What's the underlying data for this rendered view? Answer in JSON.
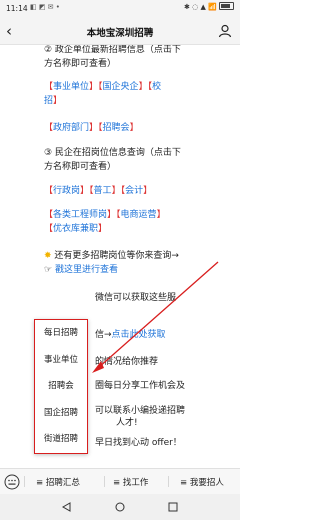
{
  "status_bar": {
    "time": "11:14",
    "left_icons": "◧ ◩ ✉ •",
    "right_icons": "✱ ◌ ▲ 📶"
  },
  "header": {
    "title": "本地宝深圳招聘"
  },
  "article": {
    "l1": "② 政企单位最新招聘信息（点击下",
    "l2": "方名称即可查看）",
    "l3": [
      "【",
      "事业单位",
      "】【",
      "国企央企",
      "】【",
      "校"
    ],
    "l4": [
      "招",
      "】"
    ],
    "l5": [
      "【",
      "政府部门",
      "】【",
      "招聘会",
      "】"
    ],
    "l6": "③ 民企在招岗位信息查询（点击下",
    "l7": "方名称即可查看）",
    "l8": [
      "【",
      "行政岗",
      "】【",
      "普工",
      "】【",
      "会计",
      "】"
    ],
    "l9": [
      "【",
      "各类工程师岗",
      "】【",
      "电商运营",
      "】"
    ],
    "l10": [
      "【",
      "优衣库兼职",
      "】"
    ],
    "l11": "还有更多招聘岗位等你来查询→",
    "l12": "戳这里进行查看",
    "l13": "微信可以获取这些服",
    "l14": [
      "信→",
      "点击此处获取"
    ],
    "l15": "的情况给你推荐",
    "l16": "圈每日分享工作机会及",
    "l17": "可以联系小编投递招聘",
    "l18": "人才!",
    "l19": "早日找到心动 offer！"
  },
  "popup_menu": {
    "items": [
      "每日招聘",
      "事业单位",
      "招聘会",
      "国企招聘",
      "街道招聘"
    ]
  },
  "bottom_menu": {
    "tabs": [
      "招聘汇总",
      "找工作",
      "我要招人"
    ]
  },
  "colors": {
    "link": "#1e73d8",
    "bracket": "#d33333",
    "highlight": "#d81e1e"
  }
}
